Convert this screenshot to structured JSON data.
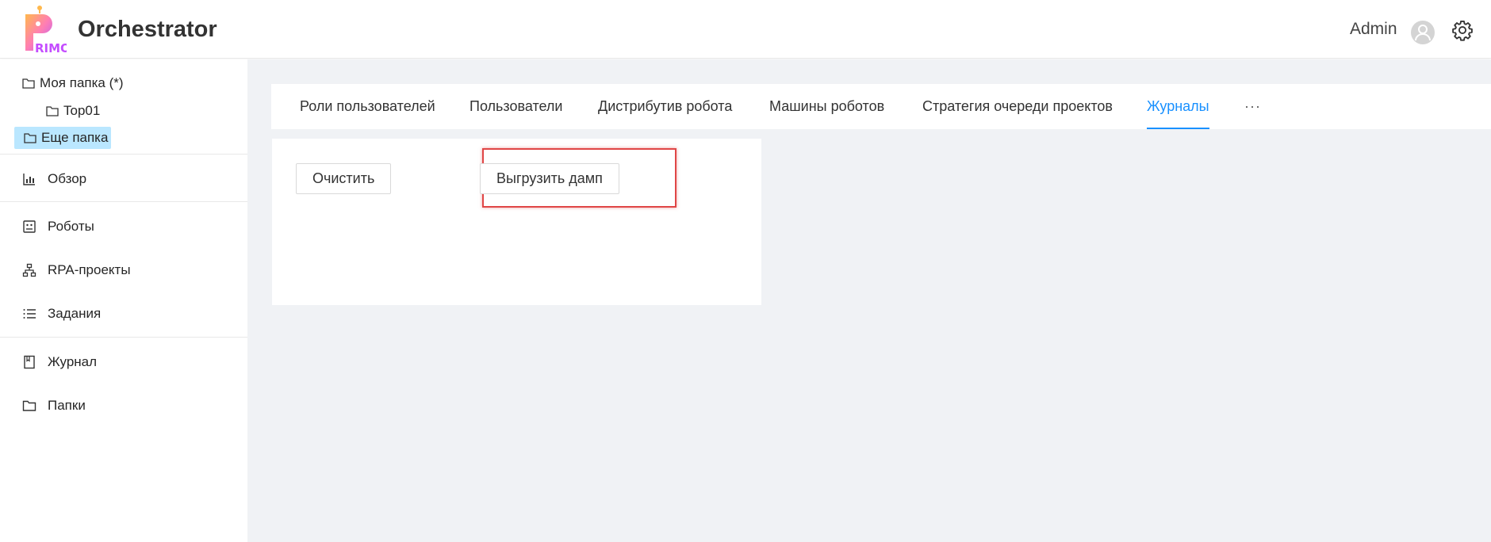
{
  "header": {
    "logo_text": "RIMO",
    "app_title": "Orchestrator",
    "user_name": "Admin"
  },
  "folders": [
    {
      "label": "Моя папка (*)"
    },
    {
      "label": "Top01"
    },
    {
      "label": "Еще папка"
    }
  ],
  "nav": [
    {
      "label": "Обзор",
      "icon": "chart-icon"
    },
    {
      "label": "Роботы",
      "icon": "robot-icon"
    },
    {
      "label": "RPA-проекты",
      "icon": "hierarchy-icon"
    },
    {
      "label": "Задания",
      "icon": "list-icon"
    },
    {
      "label": "Журнал",
      "icon": "book-icon"
    },
    {
      "label": "Папки",
      "icon": "folder-icon"
    }
  ],
  "tabs": [
    {
      "label": "Роли пользователей"
    },
    {
      "label": "Пользователи"
    },
    {
      "label": "Дистрибутив робота"
    },
    {
      "label": "Машины роботов"
    },
    {
      "label": "Стратегия очереди проектов"
    },
    {
      "label": "Журналы",
      "active": true
    },
    {
      "label": "···"
    }
  ],
  "panel": {
    "clear_button": "Очистить",
    "dump_button": "Выгрузить дамп"
  },
  "colors": {
    "accent": "#1890ff",
    "selected_folder_bg": "#bae7ff",
    "content_bg": "#f0f2f5",
    "highlight_border": "#e04646"
  }
}
